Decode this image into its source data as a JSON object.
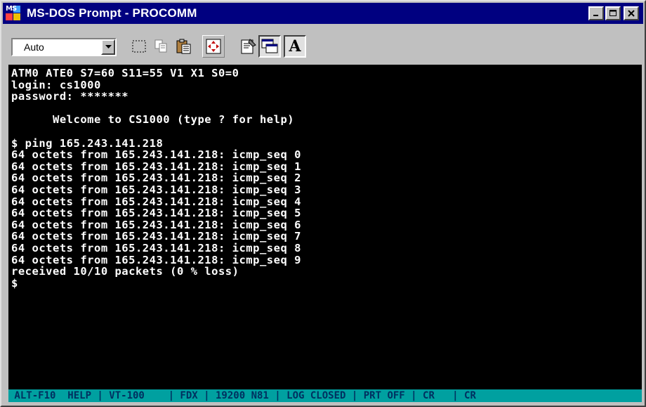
{
  "window": {
    "title": "MS-DOS Prompt - PROCOMM",
    "app_icon_text": "MS",
    "controls": {
      "minimize": "_",
      "maximize": "□",
      "close": "✕"
    }
  },
  "toolbar": {
    "font_size": "Auto",
    "buttons": [
      "mark-icon",
      "copy-icon",
      "paste-icon",
      "fullscreen-icon",
      "properties-icon",
      "background-icon",
      "font-icon"
    ],
    "font_button_label": "A"
  },
  "terminal": {
    "lines": [
      "ATM0 ATE0 S7=60 S11=55 V1 X1 S0=0",
      "login: cs1000",
      "password: *******",
      "",
      "      Welcome to CS1000 (type ? for help)",
      "",
      "$ ping 165.243.141.218",
      "64 octets from 165.243.141.218: icmp_seq 0",
      "64 octets from 165.243.141.218: icmp_seq 1",
      "64 octets from 165.243.141.218: icmp_seq 2",
      "64 octets from 165.243.141.218: icmp_seq 3",
      "64 octets from 165.243.141.218: icmp_seq 4",
      "64 octets from 165.243.141.218: icmp_seq 5",
      "64 octets from 165.243.141.218: icmp_seq 6",
      "64 octets from 165.243.141.218: icmp_seq 7",
      "64 octets from 165.243.141.218: icmp_seq 8",
      "64 octets from 165.243.141.218: icmp_seq 9",
      "received 10/10 packets (0 % loss)",
      "$"
    ],
    "status": " ALT-F10  HELP | VT-100    | FDX | 19200 N81 | LOG CLOSED | PRT OFF | CR   | CR"
  },
  "colors": {
    "title_bg": "#000080",
    "terminal_bg": "#000000",
    "terminal_fg": "#ffffff",
    "status_bg": "#00a0a0"
  }
}
